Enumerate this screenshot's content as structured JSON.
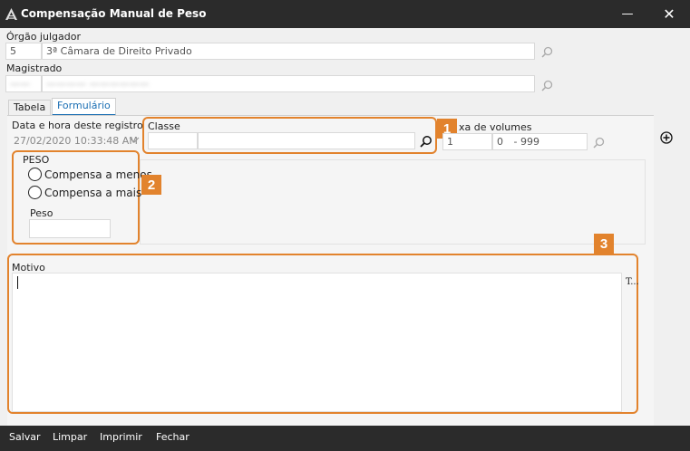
{
  "window": {
    "title": "Compensação Manual de Peso",
    "minimize": "—",
    "close": "✕"
  },
  "orgao": {
    "label": "Órgão julgador",
    "code": "5",
    "name": "3ª Câmara de Direito Privado"
  },
  "magistrado": {
    "label": "Magistrado",
    "code": "——",
    "name": "———— ——————"
  },
  "tabs": [
    {
      "label": "Tabela"
    },
    {
      "label": "Formulário"
    }
  ],
  "form": {
    "datetime_label": "Data e hora deste registro",
    "datetime_value": "27/02/2020 10:33:48 AM",
    "classe_label": "Classe",
    "classe_code": "",
    "classe_name": "",
    "volumes_label": "xa de volumes",
    "volumes_from": "1",
    "volumes_to": "0",
    "volumes_to_suffix": "- 999",
    "peso_group_label": "PESO",
    "radio_menos": "Compensa a menos",
    "radio_mais": "Compensa a mais",
    "peso_label": "Peso",
    "peso_value": "",
    "motivo_label": "Motivo",
    "motivo_value": "",
    "motivo_side_text": "T..."
  },
  "annotations": {
    "badge1": "1",
    "badge2": "2",
    "badge3": "3",
    "color": "#e2832d"
  },
  "footer": {
    "salvar": "Salvar",
    "limpar": "Limpar",
    "imprimir": "Imprimir",
    "fechar": "Fechar"
  }
}
